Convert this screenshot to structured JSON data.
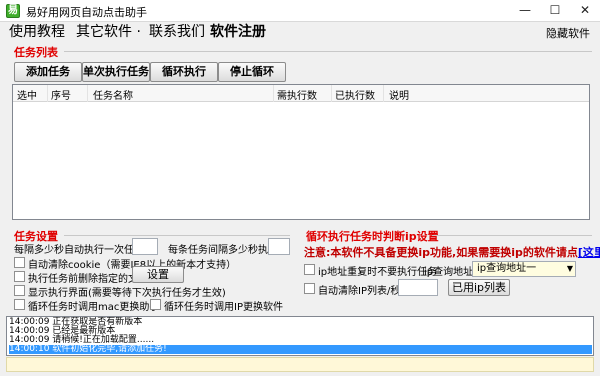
{
  "window": {
    "title": "易好用网页自动点击助手",
    "icon_glyph": "易",
    "minimize": "—",
    "maximize": "☐",
    "close": "✕"
  },
  "menu": {
    "items": [
      "使用教程",
      "其它软件 ·",
      "联系我们",
      "软件注册"
    ],
    "hide": "隐藏软件"
  },
  "task_list": {
    "title": "任务列表",
    "buttons": {
      "add": "添加任务",
      "run_once": "单次执行任务",
      "loop": "循环执行",
      "stop": "停止循环"
    },
    "columns": [
      "选中",
      "序号",
      "任务名称",
      "需执行数",
      "已执行数",
      "说明"
    ]
  },
  "task_settings": {
    "title": "任务设置",
    "interval_label": "每隔多少秒自动执行一次任务:",
    "interval_value": "",
    "per_task_label": "每条任务间隔多少秒执行:",
    "per_task_value": "",
    "options": [
      {
        "label": "自动清除cookie（需要IE8以上的新本才支持）",
        "checked": false
      },
      {
        "label": "执行任务前删除指定的文件",
        "checked": false
      },
      {
        "label": "显示执行界面(需要等待下次执行任务才生效)",
        "checked": false
      },
      {
        "label": "循环任务时调用mac更换助手",
        "checked": false
      },
      {
        "label": "循环任务时调用IP更换软件",
        "checked": false
      }
    ],
    "settings_button": "设置"
  },
  "ip_settings": {
    "title": "循环执行任务时判断ip设置",
    "notice_prefix": "注意:本软件不具备更换ip功能,如果需要换ip的软件请点",
    "notice_link": "[这里]",
    "repeat_label": "ip地址重复时不要执行任务",
    "query_label": "ip查询地址:",
    "query_selected": "ip查询地址一",
    "auto_clear_label": "自动清除IP列表/秒:",
    "auto_clear_value": "",
    "used_list_button": "已用ip列表",
    "repeat_checked": false,
    "auto_clear_checked": false
  },
  "log": {
    "lines": [
      "14:00:09 正在获取是否有新版本",
      "14:00:09 已经是最新版本",
      "14:00:09 请稍候!正在加载配置......",
      "14:00:10 软件初始化完毕,请添加任务!"
    ],
    "selected_index": 3
  },
  "colors": {
    "section_title": "#e00000",
    "log_selection": "#3399ff",
    "status_bar": "#fff8d8"
  }
}
